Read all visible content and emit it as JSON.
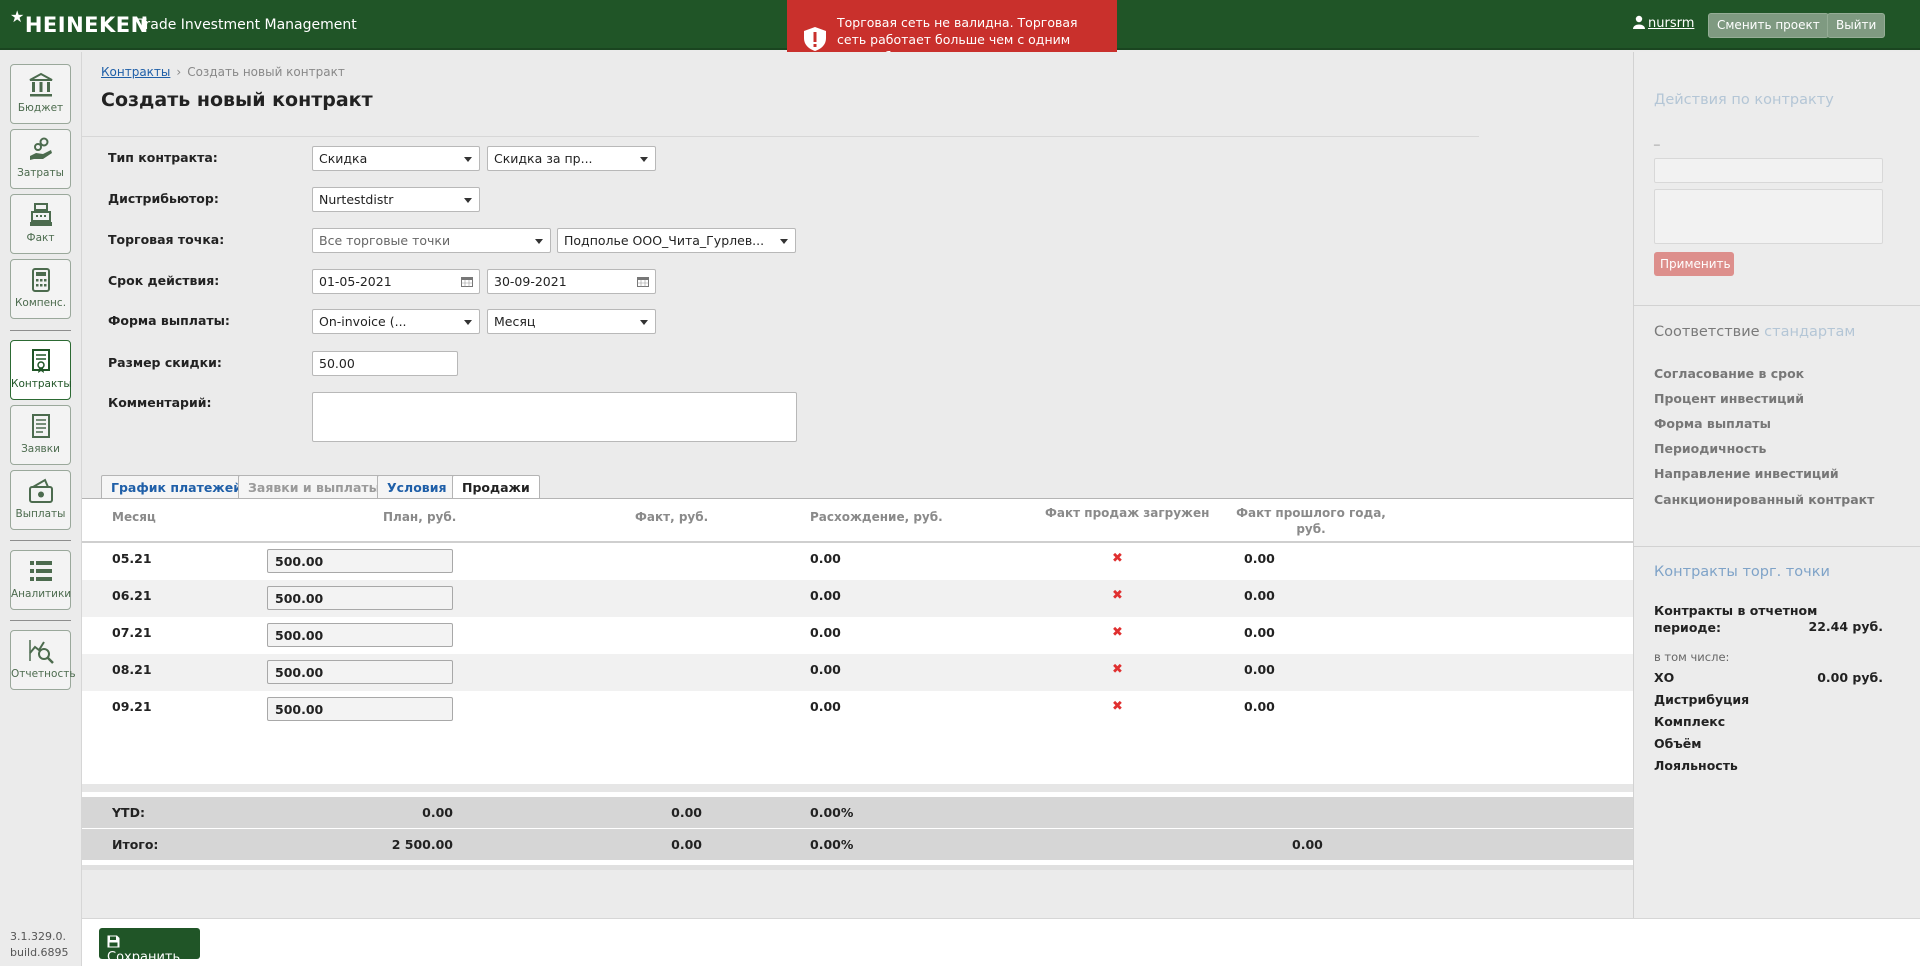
{
  "header": {
    "logo": "HEINEKEN",
    "app_title": "Trade Investment Management",
    "user": "nursrm",
    "change_project": "Сменить проект",
    "logout": "Выйти"
  },
  "toast": {
    "message": "Торговая сеть не валидна. Торговая сеть работает больше чем с одним дистрибьютором.."
  },
  "sidebar": {
    "items": [
      {
        "label": "Бюджет",
        "icon": "bank-icon"
      },
      {
        "label": "Затраты",
        "icon": "hand-coins-icon"
      },
      {
        "label": "Факт",
        "icon": "cash-register-icon"
      },
      {
        "label": "Компенс.",
        "icon": "calculator-icon"
      },
      {
        "label": "Контракты",
        "icon": "contract-icon"
      },
      {
        "label": "Заявки",
        "icon": "list-document-icon"
      },
      {
        "label": "Выплаты",
        "icon": "wallet-icon"
      },
      {
        "label": "Аналитики",
        "icon": "list-icon"
      },
      {
        "label": "Отчетность",
        "icon": "chart-search-icon"
      }
    ],
    "version_line1": "3.1.329.0.",
    "version_line2": "build.6895"
  },
  "breadcrumb": {
    "parent": "Контракты",
    "current": "Создать новый контракт"
  },
  "page_title": "Создать новый контракт",
  "form": {
    "contract_type_label": "Тип контракта:",
    "contract_type": "Скидка",
    "contract_subtype": "Скидка за пр...",
    "distributor_label": "Дистрибьютор:",
    "distributor": "Nurtestdistr",
    "outlet_label": "Торговая точка:",
    "outlet_scope": "Все торговые точки",
    "outlet": "Подполье ООО_Чита_Гурлев...",
    "period_label": "Срок действия:",
    "date_from": "01-05-2021",
    "date_to": "30-09-2021",
    "payment_form_label": "Форма выплаты:",
    "payment_form": "On-invoice (...",
    "payment_period": "Месяц",
    "discount_label": "Размер скидки:",
    "discount": "50.00",
    "comment_label": "Комментарий:"
  },
  "tabs": [
    {
      "label": "График платежей",
      "state": "link"
    },
    {
      "label": "Заявки и выплаты",
      "state": "disabled"
    },
    {
      "label": "Условия",
      "state": "link"
    },
    {
      "label": "Продажи",
      "state": "active"
    }
  ],
  "table": {
    "headers": {
      "month": "Месяц",
      "plan": "План, руб.",
      "fact": "Факт, руб.",
      "diff": "Расхождение, руб.",
      "loaded": "Факт продаж загружен",
      "prev_year_1": "Факт прошлого года,",
      "prev_year_2": "руб."
    },
    "rows": [
      {
        "month": "05.21",
        "plan": "500.00",
        "diff": "0.00",
        "loaded": "✖",
        "prev": "0.00"
      },
      {
        "month": "06.21",
        "plan": "500.00",
        "diff": "0.00",
        "loaded": "✖",
        "prev": "0.00"
      },
      {
        "month": "07.21",
        "plan": "500.00",
        "diff": "0.00",
        "loaded": "✖",
        "prev": "0.00"
      },
      {
        "month": "08.21",
        "plan": "500.00",
        "diff": "0.00",
        "loaded": "✖",
        "prev": "0.00"
      },
      {
        "month": "09.21",
        "plan": "500.00",
        "diff": "0.00",
        "loaded": "✖",
        "prev": "0.00"
      }
    ],
    "ytd": {
      "label": "YTD:",
      "plan": "0.00",
      "fact": "0.00",
      "diff": "0.00%"
    },
    "total": {
      "label": "Итого:",
      "plan": "2 500.00",
      "fact": "0.00",
      "diff": "0.00%",
      "prev": "0.00"
    }
  },
  "right_panel": {
    "actions_title": "Действия по контракту",
    "actions_dash": "_",
    "apply_button": "Применить",
    "standards_title_a": "Соответствие",
    "standards_title_b": "стандартам",
    "standards": [
      "Согласование в срок",
      "Процент инвестиций",
      "Форма выплаты",
      "Периодичность",
      "Направление инвестиций",
      "Санкционированный контракт"
    ],
    "outlet_contracts_title": "Контракты торг. точки",
    "period_contracts_label_1": "Контракты в отчетном",
    "period_contracts_label_2": "периоде:",
    "period_contracts_value": "22.44 руб.",
    "including": "в том числе:",
    "xo_label": "ХО",
    "xo_value": "0.00 руб.",
    "breakdown": [
      "Дистрибуция",
      "Комплекс",
      "Объём",
      "Лояльность"
    ]
  },
  "footer": {
    "save": "Сохранить"
  },
  "colors": {
    "brand_green": "#205527",
    "toast_red": "#c9302c",
    "link_blue": "#1f5fa8",
    "error_x": "#e03030"
  }
}
